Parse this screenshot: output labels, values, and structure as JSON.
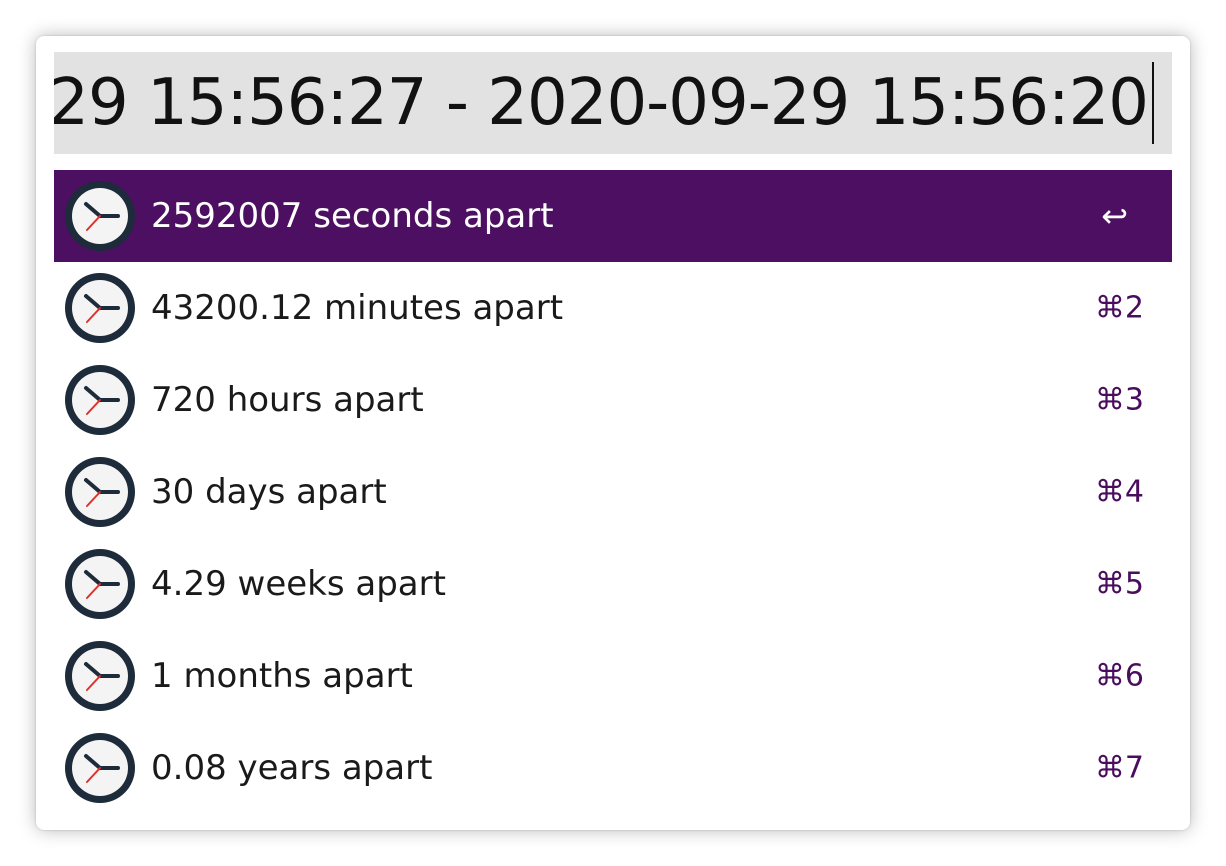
{
  "search": {
    "query": "29 15:56:27 - 2020-09-29 15:56:20"
  },
  "results": [
    {
      "title": "2592007 seconds apart",
      "shortcut": "↩",
      "icon": "clock-icon"
    },
    {
      "title": "43200.12 minutes apart",
      "shortcut": "⌘2",
      "icon": "clock-icon"
    },
    {
      "title": "720 hours apart",
      "shortcut": "⌘3",
      "icon": "clock-icon"
    },
    {
      "title": "30 days apart",
      "shortcut": "⌘4",
      "icon": "clock-icon"
    },
    {
      "title": "4.29 weeks apart",
      "shortcut": "⌘5",
      "icon": "clock-icon"
    },
    {
      "title": "1 months apart",
      "shortcut": "⌘6",
      "icon": "clock-icon"
    },
    {
      "title": "0.08 years apart",
      "shortcut": "⌘7",
      "icon": "clock-icon"
    }
  ],
  "colors": {
    "selection": "#4d0f62",
    "shortcut": "#4a0d5e",
    "search_bg": "#e2e2e2"
  }
}
